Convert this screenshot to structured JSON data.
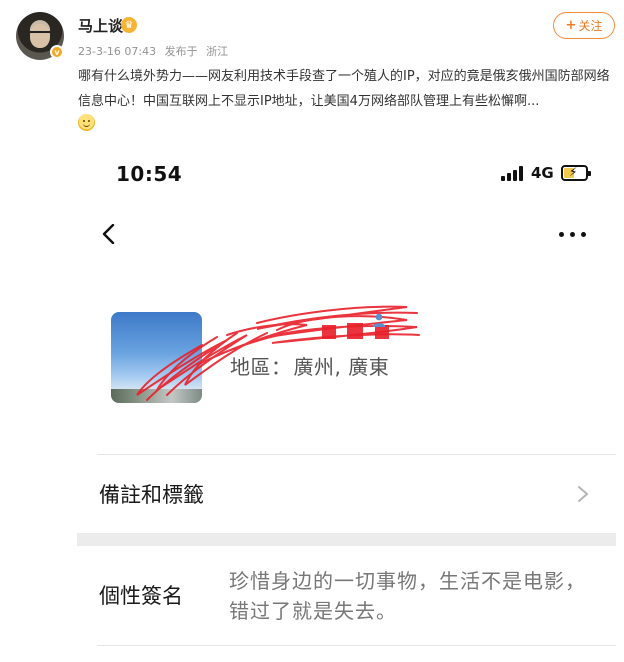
{
  "post": {
    "username": "马上谈",
    "date": "23-3-16 07:43",
    "source_prefix": "发布于",
    "location": "浙江",
    "follow_label": "关注",
    "text": "哪有什么境外势力——网友利用技术手段查了一个殖人的IP，对应的竟是俄亥俄州国防部网络信息中心！中国互联网上不显示IP地址，让美国4万网络部队管理上有些松懈啊..."
  },
  "screenshot": {
    "status_bar": {
      "time": "10:54",
      "network": "4G"
    },
    "profile": {
      "region_label": "地區：",
      "region_value": "廣州, 廣東"
    },
    "rows": {
      "remark_label": "備註和標籤",
      "signature_label": "個性簽名",
      "signature_text": "珍惜身边的一切事物，生活不是电影，错过了就是失去。"
    },
    "colors": {
      "accent_orange": "#f07a23",
      "redaction_red": "#e8202a"
    },
    "icons": [
      "back-chevron-icon",
      "more-dots-icon",
      "person-icon",
      "chevron-right-icon"
    ]
  }
}
